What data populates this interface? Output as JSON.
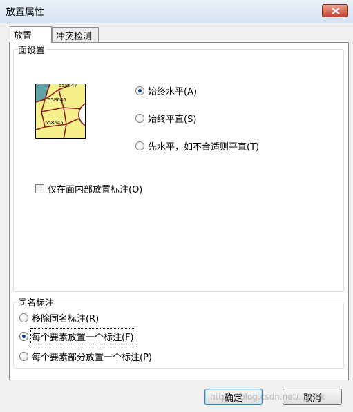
{
  "window": {
    "title": "放置属性"
  },
  "tabs": [
    {
      "label": "放置",
      "active": true
    },
    {
      "label": "冲突检测",
      "active": false
    }
  ],
  "face_settings": {
    "group_title": "面设置",
    "preview_labels": [
      "558647",
      "558646",
      "558645"
    ],
    "options": [
      {
        "label": "始终水平(A)",
        "checked": true
      },
      {
        "label": "始终平直(S)",
        "checked": false
      },
      {
        "label": "先水平，如不合适则平直(T)",
        "checked": false
      }
    ],
    "inside_only": {
      "label": "仅在面内部放置标注(O)",
      "checked": false
    }
  },
  "same_name": {
    "group_title": "同名标注",
    "options": [
      {
        "label": "移除同名标注(R)",
        "checked": false
      },
      {
        "label": "每个要素放置一个标注(F)",
        "checked": true
      },
      {
        "label": "每个要素部分放置一个标注(P)",
        "checked": false
      }
    ]
  },
  "buttons": {
    "ok": "确定",
    "cancel": "取消"
  },
  "watermark": "https://blog.csdn.net/...wick",
  "colors": {
    "preview_fill": "#f5f08c",
    "preview_line": "#8b1a1a",
    "preview_water": "#5fa3a8"
  }
}
